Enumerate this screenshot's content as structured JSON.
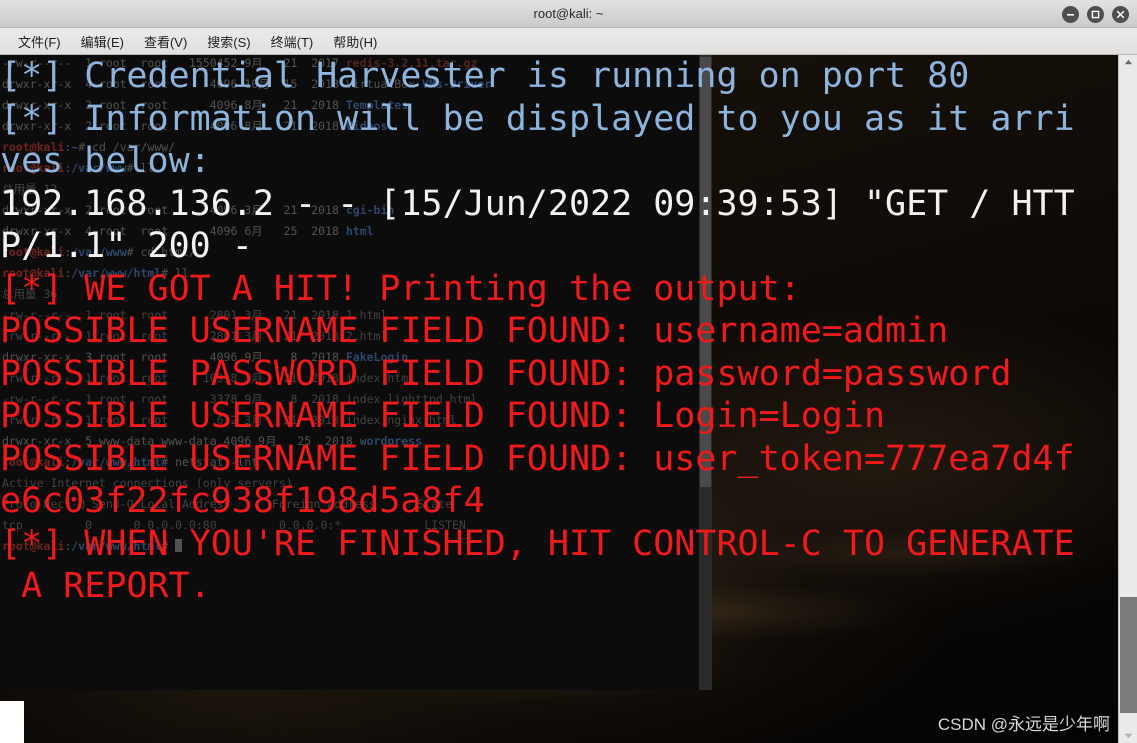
{
  "window": {
    "title": "root@kali: ~",
    "controls": [
      {
        "name": "minimize",
        "glyph": "minimize-icon"
      },
      {
        "name": "maximize",
        "glyph": "maximize-icon"
      },
      {
        "name": "close",
        "glyph": "close-icon"
      }
    ]
  },
  "menubar": {
    "items": [
      {
        "label": "文件(F)"
      },
      {
        "label": "编辑(E)"
      },
      {
        "label": "查看(V)"
      },
      {
        "label": "搜索(S)"
      },
      {
        "label": "终端(T)"
      },
      {
        "label": "帮助(H)"
      }
    ]
  },
  "terminal": {
    "magnified_lines": [
      {
        "color": "blue",
        "text": "[*] Credential Harvester is running on port 80"
      },
      {
        "color": "blue",
        "text": "[*] Information will be displayed to you as it arri"
      },
      {
        "color": "blue",
        "text": "ves below:"
      },
      {
        "color": "white",
        "text": "192.168.136.2 - - [15/Jun/2022 09:39:53] \"GET / HTT"
      },
      {
        "color": "white",
        "text": "P/1.1\" 200 -"
      },
      {
        "color": "red",
        "text": "[*] WE GOT A HIT! Printing the output:"
      },
      {
        "color": "red",
        "text": "POSSIBLE USERNAME FIELD FOUND: username=admin"
      },
      {
        "color": "red",
        "text": "POSSIBLE PASSWORD FIELD FOUND: password=password"
      },
      {
        "color": "red",
        "text": "POSSIBLE USERNAME FIELD FOUND: Login=Login"
      },
      {
        "color": "red",
        "text": "POSSIBLE USERNAME FIELD FOUND: user_token=777ea7d4f"
      },
      {
        "color": "red",
        "text": "e6c03f22fc938f198d5a8f4"
      },
      {
        "color": "red",
        "text": "[*] WHEN YOU'RE FINISHED, HIT CONTROL-C TO GENERATE"
      },
      {
        "color": "red",
        "text": " A REPORT."
      }
    ],
    "scrollback": [
      "-rw-r--r--  1 root  root   1550452 9月   21  2017 redis-3.2.11.tar.gz",
      "drwxr-xr-x  4 root  root      4096 10月  15  2018 VirtualBox VMs-Driver",
      "drwxr-xr-x  2 root  root      4096 8月   21  2018 Templates",
      "drwxr-xr-x  2 root  root      4096 8月   21  2018 Videos",
      "root@kali:~# cd /var/www/",
      "root@kali:/var/www# ll",
      "总用量 12",
      "drwxr-xr-x  2 root  root      4096 3月   21  2018 cgi-bin",
      "drwxr-xr-x  4 root  root      4096 6月   25  2018 html",
      "root@kali:/var/www# cd html/",
      "root@kali:/var/www/html# ll",
      "总用量 36",
      "-rw-r--r--  1 root  root      2801 3月   21  2018 1.html",
      "-rw-r--r--  1 root  root      2801 3月   21  2018 2.html",
      "drwxr-xr-x  3 root  root      4096 9月    8  2018 FakeLogin",
      "-rw-r--r--  1 root  root     10918 3月   21  2018 index.html",
      "-rw-r--r--  1 root  root      3378 9月    8  2018 index.lighttpd.html",
      "-rw-r--r--  1 root  root       612 3月   21  2018 index.nginx.html",
      "drwxr-xr-x  5 www-data www-data 4096 9月   25  2018 wordpress",
      "root@kali:/var/www/html# netstat -lnt",
      "Active Internet connections (only servers)",
      "Proto Recv-Q Send-Q Local Address      Foreign Address      State",
      "tcp         0      0 0.0.0.0:80         0.0.0.0:*            LISTEN",
      "root@kali:/var/www/html# "
    ]
  },
  "watermark": {
    "text": "CSDN @永远是少年啊"
  }
}
